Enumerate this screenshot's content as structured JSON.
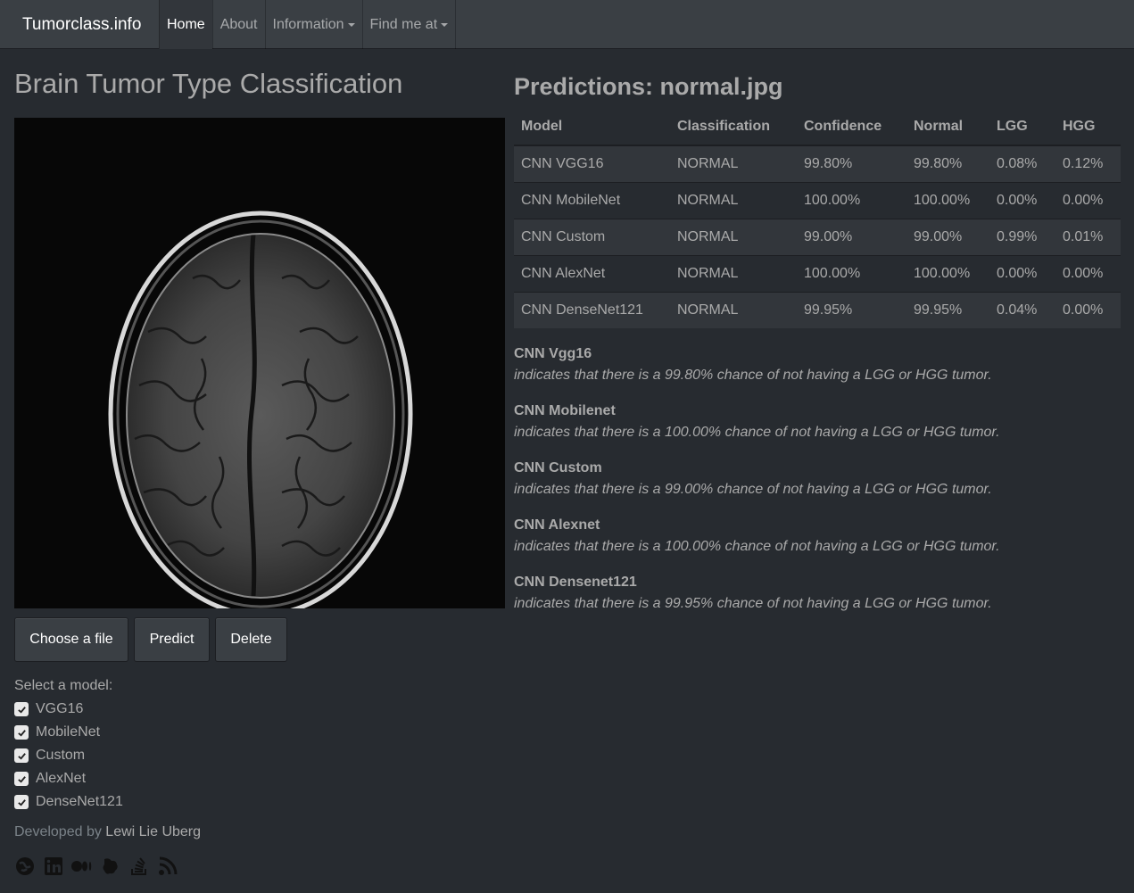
{
  "navbar": {
    "brand": "Tumorclass.info",
    "items": [
      {
        "label": "Home",
        "active": true,
        "dropdown": false
      },
      {
        "label": "About",
        "active": false,
        "dropdown": false
      },
      {
        "label": "Information",
        "active": false,
        "dropdown": true
      },
      {
        "label": "Find me at",
        "active": false,
        "dropdown": true
      }
    ]
  },
  "left": {
    "title": "Brain Tumor Type Classification",
    "buttons": {
      "choose": "Choose a file",
      "predict": "Predict",
      "delete": "Delete"
    },
    "model_label": "Select a model:",
    "models": [
      {
        "label": "VGG16",
        "checked": true
      },
      {
        "label": "MobileNet",
        "checked": true
      },
      {
        "label": "Custom",
        "checked": true
      },
      {
        "label": "AlexNet",
        "checked": true
      },
      {
        "label": "DenseNet121",
        "checked": true
      }
    ],
    "developed_by": "Developed by",
    "developer": "Lewi Lie Uberg",
    "social_icons": [
      "globe-icon",
      "linkedin-icon",
      "medium-icon",
      "kaggle-icon",
      "stackoverflow-icon",
      "rss-icon"
    ]
  },
  "right": {
    "title": "Predictions: normal.jpg",
    "table": {
      "headers": [
        "Model",
        "Classification",
        "Confidence",
        "Normal",
        "LGG",
        "HGG"
      ],
      "rows": [
        [
          "CNN VGG16",
          "NORMAL",
          "99.80%",
          "99.80%",
          "0.08%",
          "0.12%"
        ],
        [
          "CNN MobileNet",
          "NORMAL",
          "100.00%",
          "100.00%",
          "0.00%",
          "0.00%"
        ],
        [
          "CNN Custom",
          "NORMAL",
          "99.00%",
          "99.00%",
          "0.99%",
          "0.01%"
        ],
        [
          "CNN AlexNet",
          "NORMAL",
          "100.00%",
          "100.00%",
          "0.00%",
          "0.00%"
        ],
        [
          "CNN DenseNet121",
          "NORMAL",
          "99.95%",
          "99.95%",
          "0.04%",
          "0.00%"
        ]
      ]
    },
    "explanations": [
      {
        "title": "CNN Vgg16",
        "text": "indicates that there is a 99.80% chance of not having a LGG or HGG tumor."
      },
      {
        "title": "CNN Mobilenet",
        "text": "indicates that there is a 100.00% chance of not having a LGG or HGG tumor."
      },
      {
        "title": "CNN Custom",
        "text": "indicates that there is a 99.00% chance of not having a LGG or HGG tumor."
      },
      {
        "title": "CNN Alexnet",
        "text": "indicates that there is a 100.00% chance of not having a LGG or HGG tumor."
      },
      {
        "title": "CNN Densenet121",
        "text": "indicates that there is a 99.95% chance of not having a LGG or HGG tumor."
      }
    ]
  }
}
